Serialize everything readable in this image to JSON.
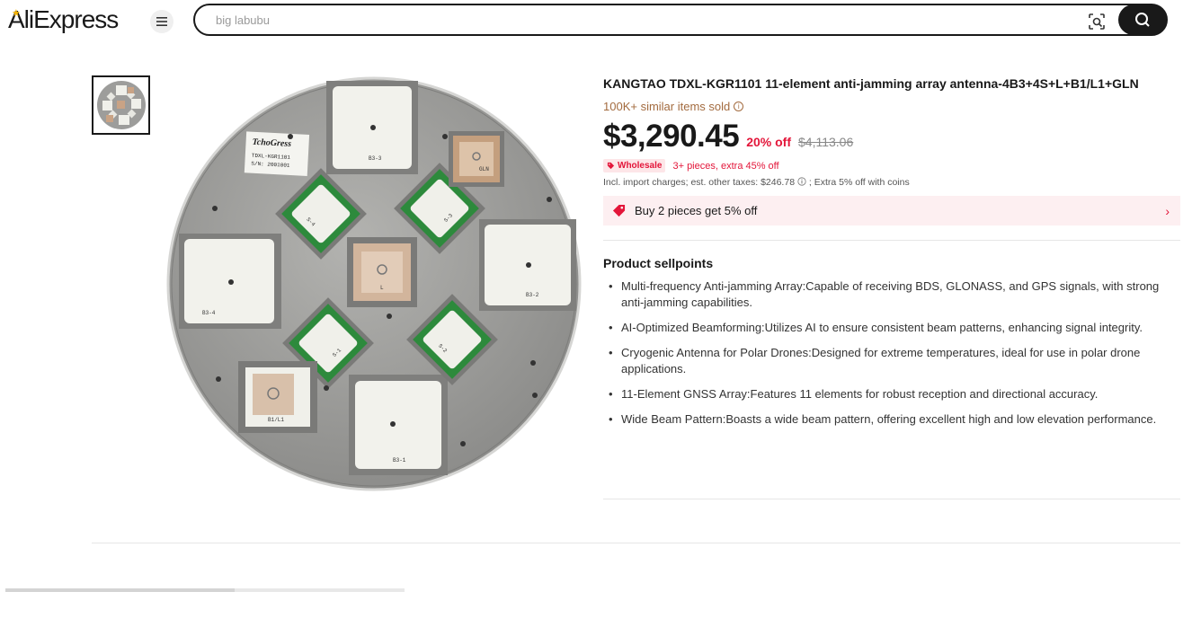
{
  "header": {
    "logo_text": "AliExpress",
    "search_placeholder": "big labubu",
    "icons": [
      "menu-icon",
      "camera-search-icon",
      "search-icon"
    ]
  },
  "colors": {
    "accent": "#e3163a",
    "brand_dark": "#191919",
    "sold_text": "#a36b3f",
    "promo_bg": "#fdeff1",
    "logo_star": "#f7b500"
  },
  "product": {
    "title": "KANGTAO TDXL-KGR1101 11-element anti-jamming array antenna-4B3+4S+L+B1/L1+GLN",
    "sold": "100K+ similar items sold",
    "price": "$3,290.45",
    "discount": "20% off",
    "original_price": "$4,113.06",
    "wholesale_badge": "Wholesale",
    "wholesale_text": "3+ pieces, extra 45% off",
    "tax_text": "Incl. import charges; est. other taxes: $246.78",
    "coins_text": "; Extra 5% off with coins",
    "promo_text": "Buy 2 pieces get 5% off",
    "sellpoints_title": "Product sellpoints",
    "sellpoints": [
      "Multi-frequency Anti-jamming Array:Capable of receiving BDS, GLONASS, and GPS signals, with strong anti-jamming capabilities.",
      "AI-Optimized Beamforming:Utilizes AI to ensure consistent beam patterns, enhancing signal integrity.",
      "Cryogenic Antenna for Polar Drones:Designed for extreme temperatures, ideal for use in polar drone applications.",
      "11-Element GNSS Array:Features 11 elements for robust reception and directional accuracy.",
      "Wide Beam Pattern:Boasts a wide beam pattern, offering excellent high and low elevation performance."
    ]
  },
  "image": {
    "plate_brand": "TchoGress",
    "plate_model": "TDXL-KGR1101",
    "plate_serial": "S/N: 2001001",
    "labels": [
      "B3-3",
      "GLN",
      "S-4",
      "S-3",
      "B3-4",
      "L",
      "B3-2",
      "S-1",
      "S-2",
      "B1/L1",
      "B3-1"
    ]
  }
}
